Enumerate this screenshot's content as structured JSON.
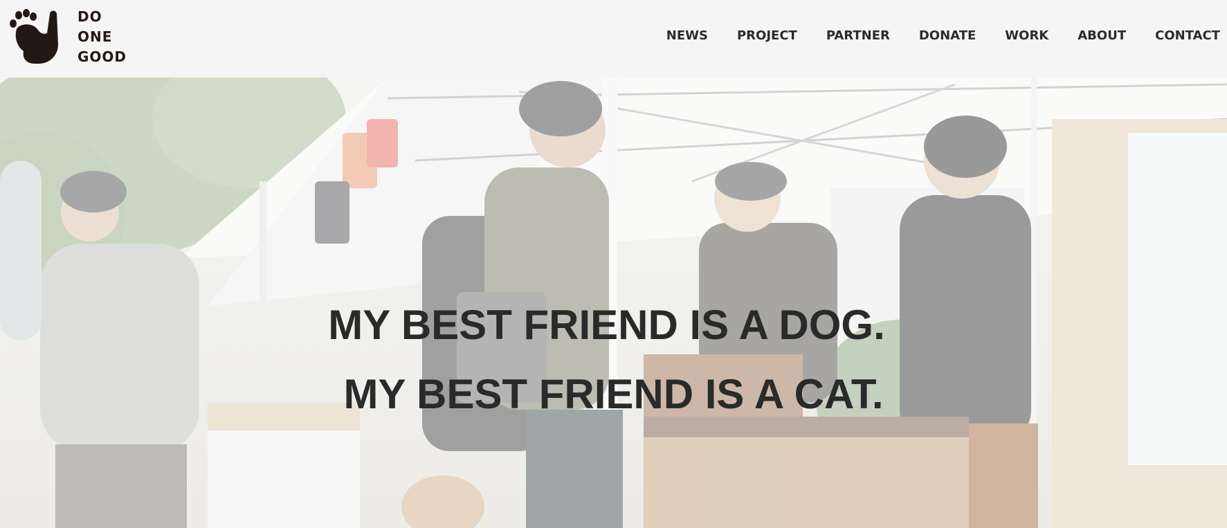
{
  "header": {
    "logo": {
      "lines": [
        "DO",
        "ONE",
        "GOOD"
      ],
      "icon": "paw-hand-icon"
    },
    "nav": [
      {
        "label": "NEWS"
      },
      {
        "label": "PROJECT"
      },
      {
        "label": "PARTNER"
      },
      {
        "label": "DONATE"
      },
      {
        "label": "WORK"
      },
      {
        "label": "ABOUT"
      },
      {
        "label": "CONTACT"
      }
    ]
  },
  "hero": {
    "headline_1": "MY BEST FRIEND IS A DOG.",
    "headline_2": "MY BEST FRIEND IS A CAT.",
    "image": "market-stall-photo"
  },
  "colors": {
    "header_bg": "#f5f5f5",
    "logo": "#231815",
    "nav_text": "#2b2b2b",
    "headline_text": "#2a2a2a"
  }
}
